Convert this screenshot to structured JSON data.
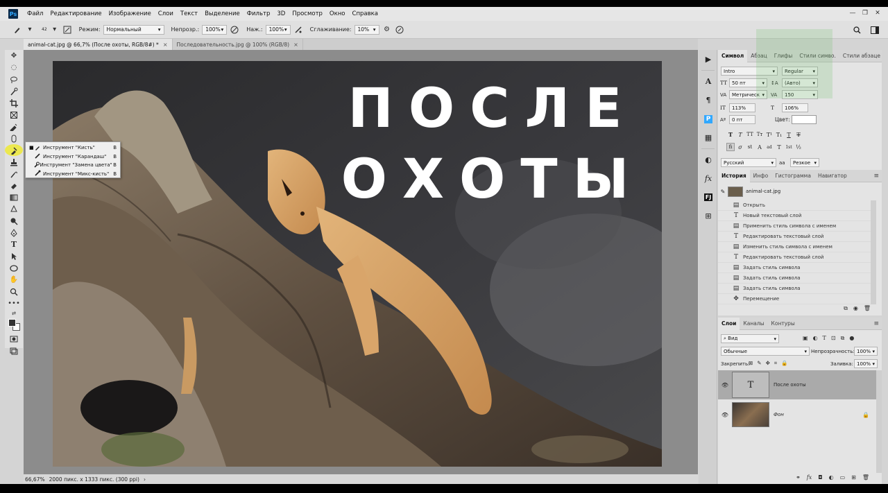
{
  "app": {
    "logo": "Ps",
    "accent": "#31a8ff"
  },
  "menu": [
    "Файл",
    "Редактирование",
    "Изображение",
    "Слои",
    "Текст",
    "Выделение",
    "Фильтр",
    "3D",
    "Просмотр",
    "Окно",
    "Справка"
  ],
  "window_controls": [
    "—",
    "❐",
    "✕"
  ],
  "options": {
    "brush_size": "42",
    "mode_label": "Режим:",
    "mode_value": "Нормальный",
    "opacity_label": "Непрозр.:",
    "opacity_value": "100%",
    "flow_label": "Наж.:",
    "flow_value": "100%",
    "smoothing_label": "Сглаживание:",
    "smoothing_value": "10%"
  },
  "tabs": [
    {
      "label": "animal-cat.jpg @ 66,7% (После охоты, RGB/8#) *",
      "close": "×"
    },
    {
      "label": "Последовательность.jpg @ 100% (RGB/8)",
      "close": "×"
    }
  ],
  "canvas": {
    "title_line1": "ПОСЛЕ",
    "title_line2": "ОХОТЫ"
  },
  "flyout": [
    {
      "label": "Инструмент \"Кисть\"",
      "key": "B",
      "mark": "■",
      "icon": "brush-icon"
    },
    {
      "label": "Инструмент \"Карандаш\"",
      "key": "B",
      "mark": "",
      "icon": "pencil-icon"
    },
    {
      "label": "Инструмент \"Замена цвета\"",
      "key": "B",
      "mark": "",
      "icon": "color-replace-icon"
    },
    {
      "label": "Инструмент \"Микс-кисть\"",
      "key": "B",
      "mark": "",
      "icon": "mixer-brush-icon"
    }
  ],
  "status": {
    "zoom": "66,67%",
    "info": "2000 пикс. x 1333 пикс. (300 ppi)",
    "arrow": "›"
  },
  "character": {
    "tabs": [
      "Символ",
      "Абзац",
      "Глифы",
      "Стили симво.",
      "Стили абзаце"
    ],
    "font_family": "Intro",
    "font_style": "Regular",
    "size": "50 пт",
    "leading": "(Авто)",
    "kerning": "Метрическ",
    "tracking": "150",
    "vscale": "113%",
    "hscale": "106%",
    "baseline": "0 пт",
    "color_label": "Цвет:",
    "language": "Русский",
    "aa_label": "aa",
    "antialias": "Резкое",
    "style_buttons": [
      "T",
      "T",
      "TT",
      "Tт",
      "T¹",
      "T₁",
      "T",
      "T"
    ],
    "ot_buttons": [
      "fi",
      "σ",
      "st",
      "A",
      "ad",
      "T",
      "1st",
      "½"
    ]
  },
  "history": {
    "tabs": [
      "История",
      "Инфо",
      "Гистограмма",
      "Навигатор"
    ],
    "snapshot": "animal-cat.jpg",
    "items": [
      {
        "label": "Открыть",
        "icon": "doc"
      },
      {
        "label": "Новый текстовый слой",
        "icon": "T"
      },
      {
        "label": "Применить стиль символа с именем",
        "icon": "doc"
      },
      {
        "label": "Редактировать текстовый слой",
        "icon": "T"
      },
      {
        "label": "Изменить стиль символа с именем",
        "icon": "doc"
      },
      {
        "label": "Редактировать текстовый слой",
        "icon": "T"
      },
      {
        "label": "Задать стиль символа",
        "icon": "doc"
      },
      {
        "label": "Задать стиль символа",
        "icon": "doc"
      },
      {
        "label": "Задать стиль символа",
        "icon": "doc"
      },
      {
        "label": "Перемещение",
        "icon": "move"
      }
    ]
  },
  "layers": {
    "tabs": [
      "Слои",
      "Каналы",
      "Контуры"
    ],
    "filter": "Вид",
    "blend": "Обычные",
    "opacity_label": "Непрозрачность:",
    "opacity": "100%",
    "lock_label": "Закрепить:",
    "fill_label": "Заливка:",
    "fill": "100%",
    "items": [
      {
        "name": "После охоты",
        "thumb": "T",
        "locked": false
      },
      {
        "name": "Фон",
        "thumb": "",
        "locked": true
      }
    ]
  }
}
